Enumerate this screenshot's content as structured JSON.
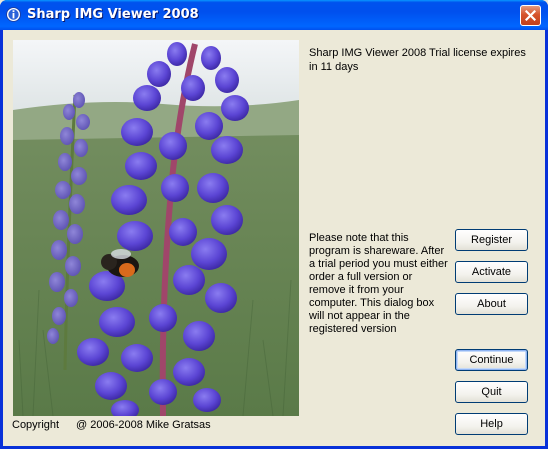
{
  "window": {
    "title": "Sharp IMG Viewer 2008",
    "title_icon": "info-icon",
    "close_icon": "close-icon"
  },
  "colors": {
    "titlebar": "#0055EA",
    "dialog_bg": "#ECE9D8",
    "close_button": "#D6532B",
    "button_border": "#003C74"
  },
  "license": {
    "message": "Sharp IMG Viewer 2008 Trial license expires in 11 days"
  },
  "note": {
    "text": "Please note that this program is shareware. After a trial period you must either order a full version or remove it from your computer. This dialog box will not appear in the registered version"
  },
  "buttons": {
    "register": "Register",
    "activate": "Activate",
    "about": "About",
    "continue": "Continue",
    "quit": "Quit",
    "help": "Help"
  },
  "footer": {
    "copyright_label": "Copyright",
    "copyright_value": "@ 2006-2008 Mike Gratsas"
  },
  "image": {
    "subject": "purple lupine flower with bumblebee"
  }
}
